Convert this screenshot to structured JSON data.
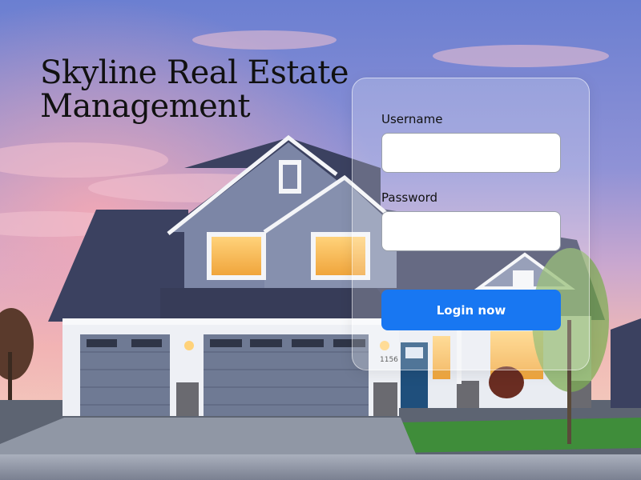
{
  "brand": {
    "title_line1": "Skyline Real Estate",
    "title_line2": "Management"
  },
  "login": {
    "username_label": "Username",
    "username_value": "",
    "password_label": "Password",
    "password_value": "",
    "button_label": "Login now"
  },
  "scene": {
    "house_number": "1156"
  },
  "colors": {
    "accent": "#1877f2",
    "sky_top": "#6b7fd1",
    "sky_glow": "#f2a1a9",
    "roof": "#3b4160",
    "siding": "#7c86a6",
    "window_glow": "#f7b84e",
    "door": "#1f4f7c",
    "lawn": "#3f8d3a",
    "driveway": "#9097a5"
  }
}
